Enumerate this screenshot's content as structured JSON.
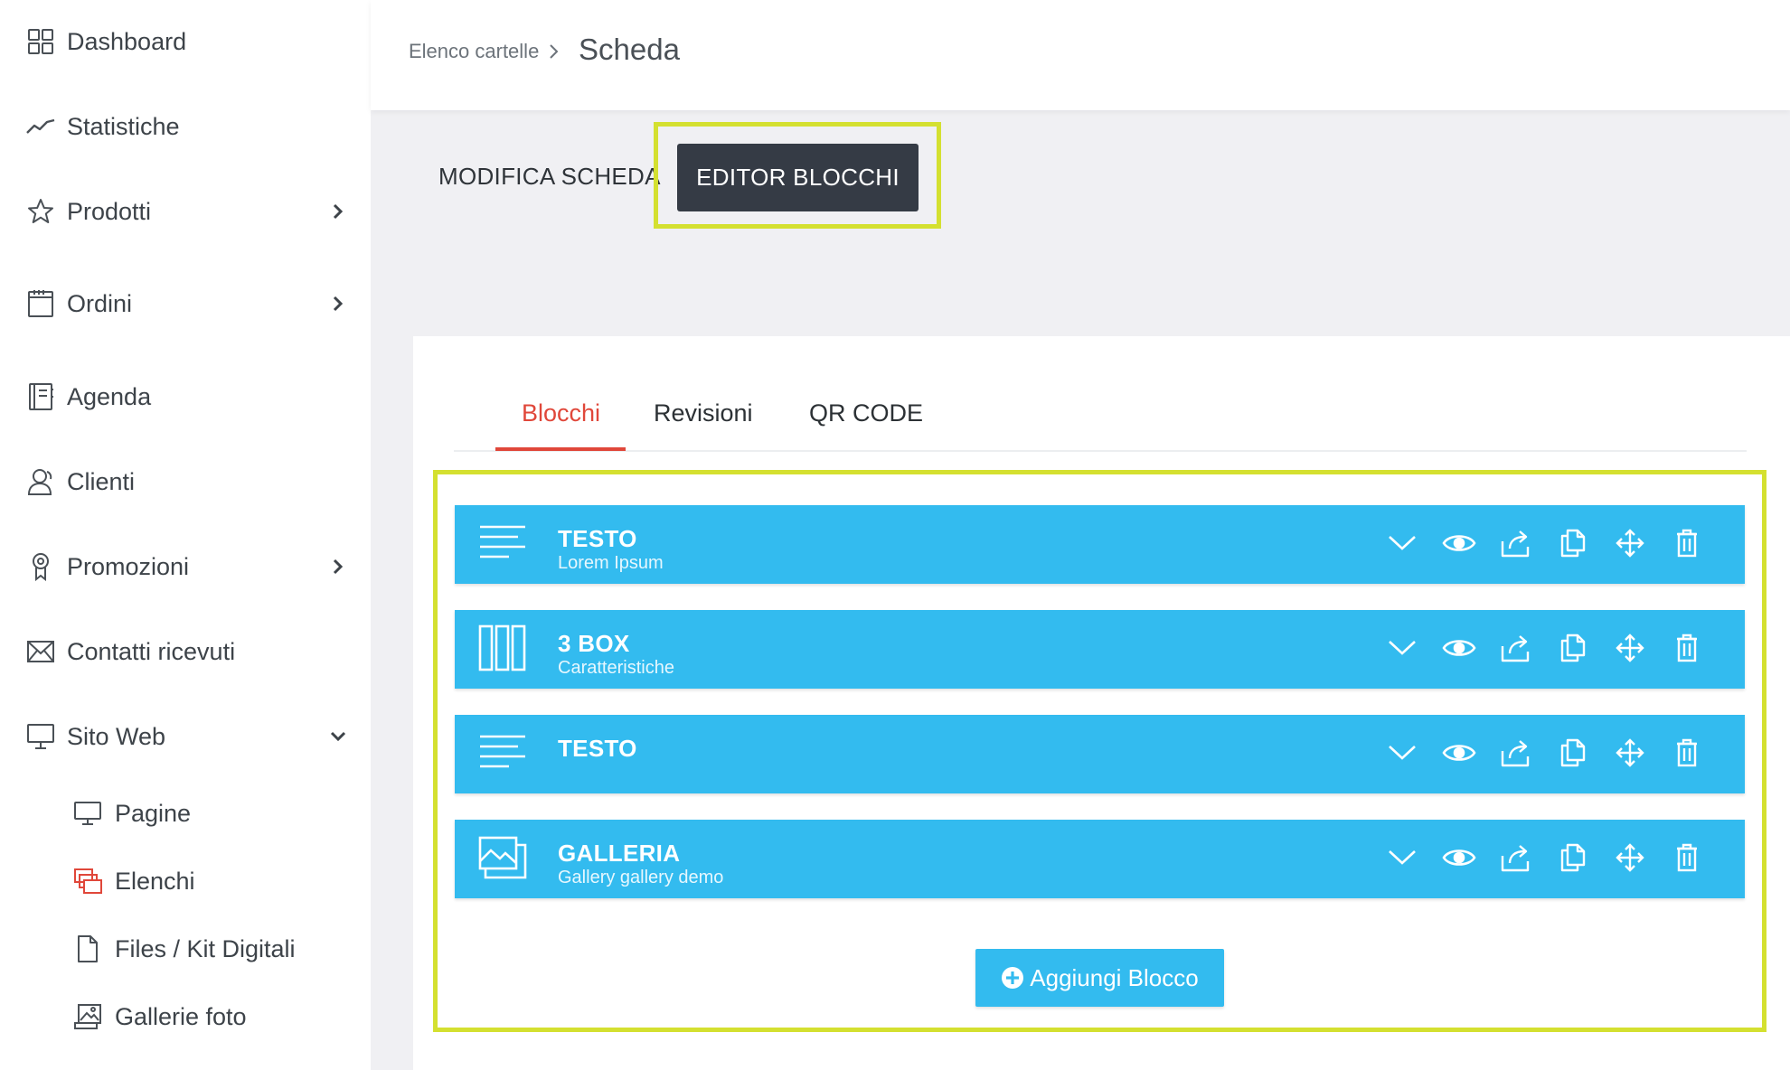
{
  "sidebar": {
    "items": [
      {
        "label": "Dashboard",
        "icon": "dashboard-grid-icon"
      },
      {
        "label": "Statistiche",
        "icon": "trend-line-icon"
      },
      {
        "label": "Prodotti",
        "icon": "star-icon",
        "expandable": true
      },
      {
        "label": "Ordini",
        "icon": "calendar-icon",
        "expandable": true
      },
      {
        "label": "Agenda",
        "icon": "notebook-icon"
      },
      {
        "label": "Clienti",
        "icon": "users-icon"
      },
      {
        "label": "Promozioni",
        "icon": "badge-icon",
        "expandable": true
      },
      {
        "label": "Contatti ricevuti",
        "icon": "envelope-icon"
      },
      {
        "label": "Sito Web",
        "icon": "monitor-icon",
        "expanded": true
      }
    ],
    "subitems": [
      {
        "label": "Pagine",
        "icon": "monitor-icon"
      },
      {
        "label": "Elenchi",
        "icon": "stacked-windows-icon",
        "active": true
      },
      {
        "label": "Files / Kit Digitali",
        "icon": "file-icon"
      },
      {
        "label": "Gallerie foto",
        "icon": "image-gallery-icon"
      }
    ]
  },
  "header": {
    "breadcrumb": "Elenco cartelle",
    "title": "Scheda"
  },
  "toolbar": {
    "modifica_label": "MODIFICA SCHEDA",
    "editor_label": "EDITOR BLOCCHI"
  },
  "tabs": [
    {
      "label": "Blocchi",
      "active": true
    },
    {
      "label": "Revisioni"
    },
    {
      "label": "QR CODE"
    }
  ],
  "blocks": [
    {
      "title": "TESTO",
      "subtitle": "Lorem Ipsum",
      "icon": "text-lines-icon"
    },
    {
      "title": "3 BOX",
      "subtitle": "Caratteristiche",
      "icon": "three-columns-icon"
    },
    {
      "title": "TESTO",
      "subtitle": "",
      "icon": "text-lines-icon"
    },
    {
      "title": "GALLERIA",
      "subtitle": "Gallery  gallery demo",
      "icon": "gallery-icon"
    }
  ],
  "block_actions": [
    "chevron-down-icon",
    "eye-icon",
    "share-icon",
    "copy-icon",
    "move-icon",
    "trash-icon"
  ],
  "add_block_label": "Aggiungi Blocco",
  "colors": {
    "accent": "#33bbef",
    "active_tab": "#e0473a",
    "dark_button": "#353b45",
    "highlight": "#d4e030"
  }
}
